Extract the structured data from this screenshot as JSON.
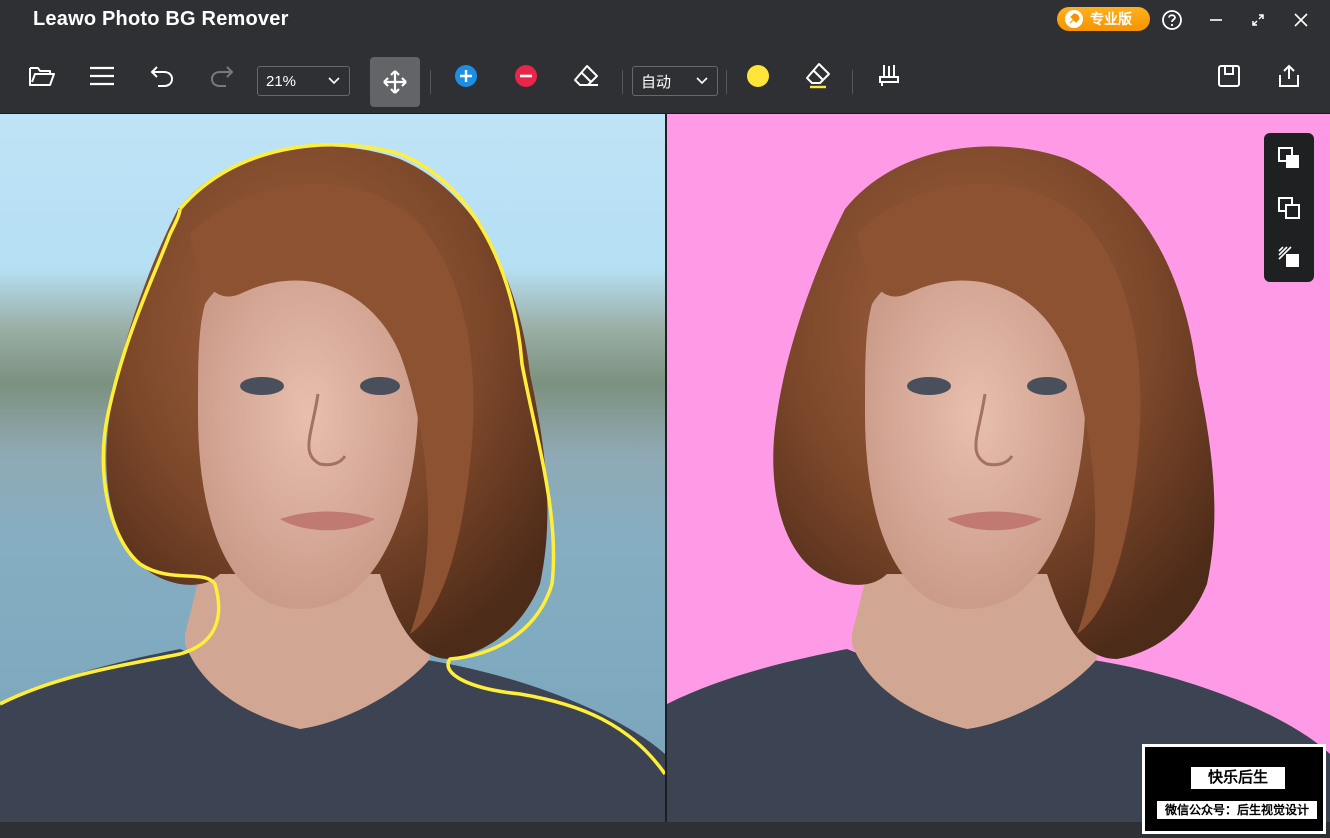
{
  "app": {
    "title": "Leawo Photo BG Remover",
    "pro_label": "专业版"
  },
  "toolbar": {
    "zoom_value": "21%",
    "mode_value": "自动",
    "buttons": [
      "open-folder",
      "menu",
      "undo",
      "redo",
      "move",
      "add-brush",
      "remove-brush",
      "eraser",
      "mark-color",
      "erase-mark",
      "stamp",
      "save",
      "export"
    ]
  },
  "colors": {
    "accent_yellow": "#ffe53a",
    "add_blue": "#1a8fe6",
    "remove_red": "#e8264b",
    "badge_orange": "#f7a10a",
    "result_bg": "#ff9be6"
  },
  "watermark": {
    "title": "快乐后生",
    "subtitle": "微信公众号：后生视觉设计"
  }
}
